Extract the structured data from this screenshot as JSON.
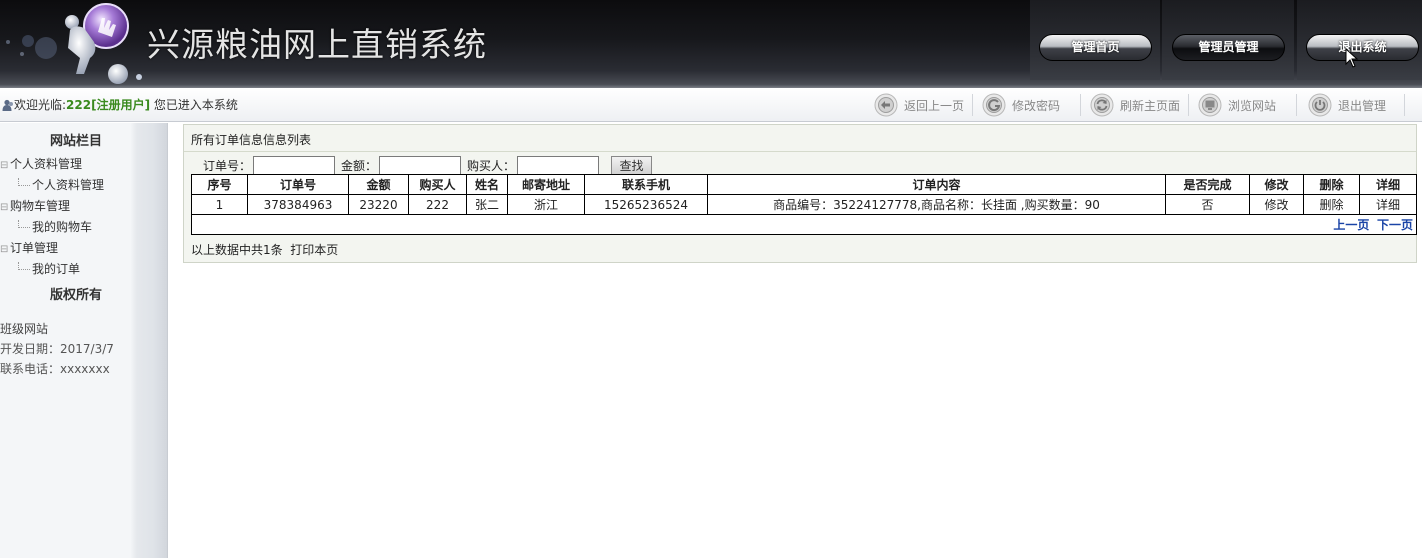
{
  "header": {
    "site_title": "兴源粮油网上直销系统",
    "nav": [
      {
        "label": "管理首页"
      },
      {
        "label": "管理员管理"
      },
      {
        "label": "退出系统"
      }
    ]
  },
  "statusbar": {
    "welcome_prefix": "欢迎光临:",
    "username": "222[注册用户]",
    "welcome_suffix": " 您已进入本系统",
    "tools": [
      {
        "label": "返回上一页",
        "icon": "back-arrow-icon"
      },
      {
        "label": "修改密码",
        "icon": "password-icon"
      },
      {
        "label": "刷新主页面",
        "icon": "refresh-icon"
      },
      {
        "label": "浏览网站",
        "icon": "browse-icon"
      },
      {
        "label": "退出管理",
        "icon": "power-icon"
      }
    ]
  },
  "sidebar": {
    "title": "网站栏目",
    "groups": [
      {
        "label": "个人资料管理",
        "children": [
          "个人资料管理"
        ]
      },
      {
        "label": "购物车管理",
        "children": [
          "我的购物车"
        ]
      },
      {
        "label": "订单管理",
        "children": [
          "我的订单"
        ]
      }
    ],
    "copyright_title": "版权所有",
    "info": [
      "班级网站",
      "开发日期：2017/3/7",
      "联系电话：xxxxxxx"
    ]
  },
  "main": {
    "title": "所有订单信息信息列表",
    "search": {
      "order_no_label": "订单号：",
      "order_no_value": "",
      "amount_label": "金额：",
      "amount_value": "",
      "buyer_label": "购买人：",
      "buyer_value": "",
      "button_label": "查找"
    },
    "table": {
      "columns": [
        "序号",
        "订单号",
        "金额",
        "购买人",
        "姓名",
        "邮寄地址",
        "联系手机",
        "订单内容",
        "是否完成",
        "修改",
        "删除",
        "详细"
      ],
      "rows": [
        {
          "seq": "1",
          "order_no": "378384963",
          "amount": "23220",
          "buyer": "222",
          "name": "张二",
          "address": "浙江",
          "phone": "15265236524",
          "content": "商品编号：35224127778,商品名称：长挂面 ,购买数量：90",
          "done": "否",
          "edit": "修改",
          "delete": "删除",
          "detail": "详细"
        }
      ],
      "prev_page": "上一页",
      "next_page": "下一页"
    },
    "footer_text": "以上数据中共1条",
    "print_label": "打印本页"
  },
  "colors": {
    "header_bg": "#141519",
    "username_green": "#3a8a1e",
    "pager_link": "#1a44a6",
    "content_bg": "#f3f5f0"
  }
}
